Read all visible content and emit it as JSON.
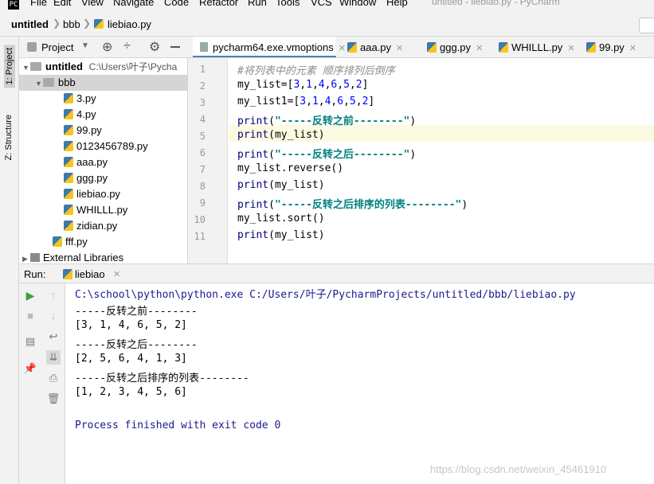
{
  "menubar": {
    "items": [
      "File",
      "Edit",
      "View",
      "Navigate",
      "Code",
      "Refactor",
      "Run",
      "Tools",
      "VCS",
      "Window",
      "Help"
    ],
    "window_title": "untitled - liebiao.py - PyCharm"
  },
  "navbar": {
    "crumbs": [
      "untitled",
      "bbb",
      "liebiao.py"
    ]
  },
  "left_strip": {
    "project_label": "1: Project",
    "structure_label": "Z: Structure"
  },
  "project_panel": {
    "header_label": "Project",
    "root": {
      "name": "untitled",
      "path": "C:\\Users\\叶子\\Pycha"
    },
    "folder": "bbb",
    "files": [
      "3.py",
      "4.py",
      "99.py",
      "0123456789.py",
      "aaa.py",
      "ggg.py",
      "liebiao.py",
      "WHILLL.py",
      "zidian.py"
    ],
    "root_file": "fff.py",
    "external": "External Libraries"
  },
  "editor": {
    "tabs": [
      "pycharm64.exe.vmoptions",
      "aaa.py",
      "ggg.py",
      "WHILLL.py",
      "99.py"
    ],
    "lines": [
      {
        "n": "1",
        "text": "#将列表中的元素 顺序排列后倒序",
        "kind": "comment"
      },
      {
        "n": "2",
        "text": "my_list=[3,1,4,6,5,2]",
        "kind": "list"
      },
      {
        "n": "3",
        "text": "my_list1=[3,1,4,6,5,2]",
        "kind": "list"
      },
      {
        "n": "4",
        "text": "print(\"-----反转之前--------\")",
        "kind": "print_str"
      },
      {
        "n": "5",
        "text": "print(my_list)",
        "kind": "print_var"
      },
      {
        "n": "6",
        "text": "print(\"-----反转之后--------\")",
        "kind": "print_str"
      },
      {
        "n": "7",
        "text": "my_list.reverse()",
        "kind": "plain"
      },
      {
        "n": "8",
        "text": "print(my_list)",
        "kind": "print_var"
      },
      {
        "n": "9",
        "text": "print(\"-----反转之后排序的列表--------\")",
        "kind": "print_str"
      },
      {
        "n": "10",
        "text": "my_list.sort()",
        "kind": "plain"
      },
      {
        "n": "11",
        "text": "print(my_list)",
        "kind": "print_var"
      }
    ],
    "current_line": 5
  },
  "run": {
    "label": "Run:",
    "tab": "liebiao",
    "output": [
      {
        "text": "C:\\school\\python\\python.exe C:/Users/叶子/PycharmProjects/untitled/bbb/liebiao.py",
        "color": "#1a1a8f"
      },
      {
        "text": "-----反转之前--------",
        "color": "#000000"
      },
      {
        "text": "[3, 1, 4, 6, 5, 2]",
        "color": "#000000"
      },
      {
        "text": "-----反转之后--------",
        "color": "#000000"
      },
      {
        "text": "[2, 5, 6, 4, 1, 3]",
        "color": "#000000"
      },
      {
        "text": "-----反转之后排序的列表--------",
        "color": "#000000"
      },
      {
        "text": "[1, 2, 3, 4, 5, 6]",
        "color": "#000000"
      },
      {
        "text": "",
        "color": "#000000"
      },
      {
        "text": "Process finished with exit code 0",
        "color": "#1a1a8f"
      }
    ]
  },
  "watermark": "https://blog.csdn.net/weixin_45461910",
  "colors": {
    "keyword_print": "#000080",
    "number": "#0000ff",
    "string": "#008080",
    "comment": "#8c8c8c",
    "active_tab": "#4083c9"
  }
}
